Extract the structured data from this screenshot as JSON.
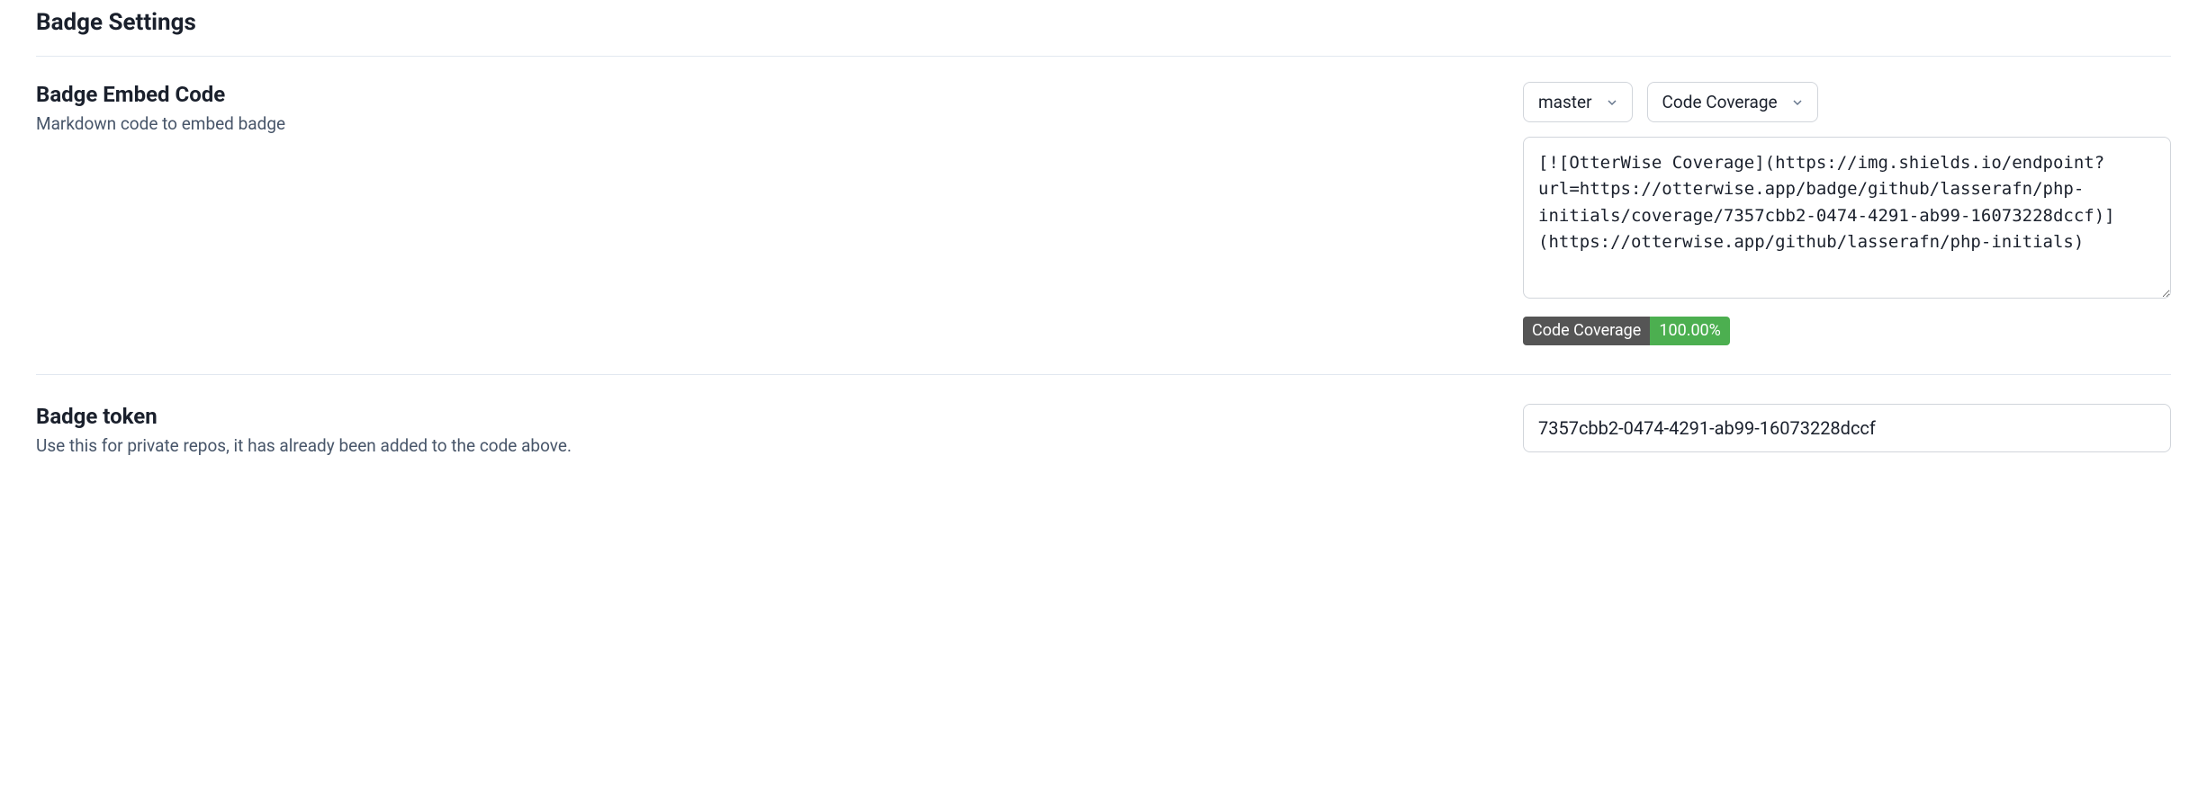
{
  "page_title": "Badge Settings",
  "embed": {
    "heading": "Badge Embed Code",
    "description": "Markdown code to embed badge",
    "branch_select": "master",
    "type_select": "Code Coverage",
    "code": "[![OtterWise Coverage](https://img.shields.io/endpoint?url=https://otterwise.app/badge/github/lasserafn/php-initials/coverage/7357cbb2-0474-4291-ab99-16073228dccf)](https://otterwise.app/github/lasserafn/php-initials)"
  },
  "badge_preview": {
    "label": "Code Coverage",
    "value": "100.00%",
    "color_left": "#555555",
    "color_right": "#4caf50"
  },
  "token": {
    "heading": "Badge token",
    "description": "Use this for private repos, it has already been added to the code above.",
    "value": "7357cbb2-0474-4291-ab99-16073228dccf"
  }
}
